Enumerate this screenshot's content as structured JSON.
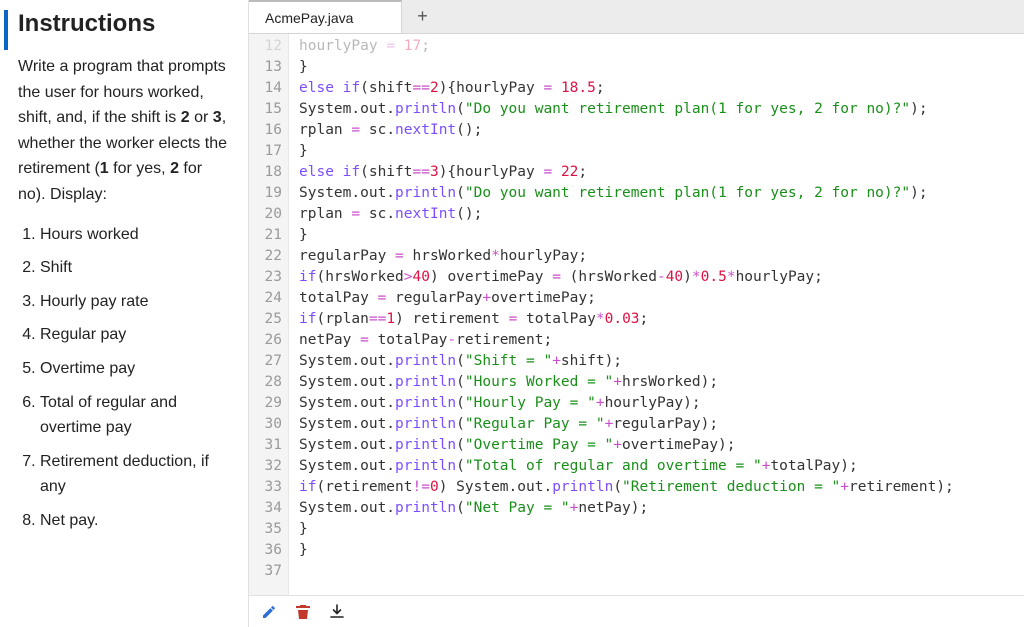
{
  "left": {
    "heading": "Instructions",
    "intro_html": "Write a program that prompts the user for hours worked, shift, and, if the shift is <b>2</b> or <b>3</b>, whether the worker elects the retirement (<b>1</b> for yes, <b>2</b> for no). Display:",
    "items": [
      "Hours worked",
      "Shift",
      "Hourly pay rate",
      "Regular pay",
      "Overtime pay",
      "Total of regular and overtime pay",
      "Retirement deduction, if any",
      "Net pay."
    ]
  },
  "tabs": {
    "active": "AcmePay.java",
    "add_label": "+"
  },
  "first_line_no": 12,
  "last_line_no": 37,
  "toolbar": {
    "edit_icon": "pencil-icon",
    "delete_icon": "trash-icon",
    "download_icon": "download-icon"
  },
  "code_lines": [
    {
      "n": 12,
      "faded": true,
      "segs": [
        [
          "id",
          "hourlyPay "
        ],
        [
          "op",
          "="
        ],
        [
          "id",
          " "
        ],
        [
          "num",
          "17"
        ],
        [
          "id",
          ";"
        ]
      ]
    },
    {
      "n": 13,
      "segs": [
        [
          "id",
          "}"
        ]
      ]
    },
    {
      "n": 14,
      "segs": [
        [
          "kw",
          "else if"
        ],
        [
          "id",
          "(shift"
        ],
        [
          "op",
          "=="
        ],
        [
          "num",
          "2"
        ],
        [
          "id",
          "){hourlyPay "
        ],
        [
          "op",
          "="
        ],
        [
          "id",
          " "
        ],
        [
          "num",
          "18.5"
        ],
        [
          "id",
          ";"
        ]
      ]
    },
    {
      "n": 15,
      "segs": [
        [
          "id",
          "System.out."
        ],
        [
          "call",
          "println"
        ],
        [
          "id",
          "("
        ],
        [
          "str",
          "\"Do you want retirement plan(1 for yes, 2 for no)?\""
        ],
        [
          "id",
          ");"
        ]
      ]
    },
    {
      "n": 16,
      "segs": [
        [
          "id",
          "rplan "
        ],
        [
          "op",
          "="
        ],
        [
          "id",
          " sc."
        ],
        [
          "call",
          "nextInt"
        ],
        [
          "id",
          "();"
        ]
      ]
    },
    {
      "n": 17,
      "segs": [
        [
          "id",
          "}"
        ]
      ]
    },
    {
      "n": 18,
      "segs": [
        [
          "kw",
          "else if"
        ],
        [
          "id",
          "(shift"
        ],
        [
          "op",
          "=="
        ],
        [
          "num",
          "3"
        ],
        [
          "id",
          "){hourlyPay "
        ],
        [
          "op",
          "="
        ],
        [
          "id",
          " "
        ],
        [
          "num",
          "22"
        ],
        [
          "id",
          ";"
        ]
      ]
    },
    {
      "n": 19,
      "segs": [
        [
          "id",
          "System.out."
        ],
        [
          "call",
          "println"
        ],
        [
          "id",
          "("
        ],
        [
          "str",
          "\"Do you want retirement plan(1 for yes, 2 for no)?\""
        ],
        [
          "id",
          ");"
        ]
      ]
    },
    {
      "n": 20,
      "segs": [
        [
          "id",
          "rplan "
        ],
        [
          "op",
          "="
        ],
        [
          "id",
          " sc."
        ],
        [
          "call",
          "nextInt"
        ],
        [
          "id",
          "();"
        ]
      ]
    },
    {
      "n": 21,
      "segs": [
        [
          "id",
          "}"
        ]
      ]
    },
    {
      "n": 22,
      "segs": [
        [
          "id",
          "regularPay "
        ],
        [
          "op",
          "="
        ],
        [
          "id",
          " hrsWorked"
        ],
        [
          "op",
          "*"
        ],
        [
          "id",
          "hourlyPay;"
        ]
      ]
    },
    {
      "n": 23,
      "segs": [
        [
          "kw",
          "if"
        ],
        [
          "id",
          "(hrsWorked"
        ],
        [
          "op",
          ">"
        ],
        [
          "num",
          "40"
        ],
        [
          "id",
          ") overtimePay "
        ],
        [
          "op",
          "="
        ],
        [
          "id",
          " (hrsWorked"
        ],
        [
          "op",
          "-"
        ],
        [
          "num",
          "40"
        ],
        [
          "id",
          ")"
        ],
        [
          "op",
          "*"
        ],
        [
          "num",
          "0.5"
        ],
        [
          "op",
          "*"
        ],
        [
          "id",
          "hourlyPay;"
        ]
      ]
    },
    {
      "n": 24,
      "segs": [
        [
          "id",
          "totalPay "
        ],
        [
          "op",
          "="
        ],
        [
          "id",
          " regularPay"
        ],
        [
          "op",
          "+"
        ],
        [
          "id",
          "overtimePay;"
        ]
      ]
    },
    {
      "n": 25,
      "segs": [
        [
          "kw",
          "if"
        ],
        [
          "id",
          "(rplan"
        ],
        [
          "op",
          "=="
        ],
        [
          "num",
          "1"
        ],
        [
          "id",
          ") retirement "
        ],
        [
          "op",
          "="
        ],
        [
          "id",
          " totalPay"
        ],
        [
          "op",
          "*"
        ],
        [
          "num",
          "0.03"
        ],
        [
          "id",
          ";"
        ]
      ]
    },
    {
      "n": 26,
      "segs": [
        [
          "id",
          "netPay "
        ],
        [
          "op",
          "="
        ],
        [
          "id",
          " totalPay"
        ],
        [
          "op",
          "-"
        ],
        [
          "id",
          "retirement;"
        ]
      ]
    },
    {
      "n": 27,
      "segs": [
        [
          "id",
          "System.out."
        ],
        [
          "call",
          "println"
        ],
        [
          "id",
          "("
        ],
        [
          "str",
          "\"Shift = \""
        ],
        [
          "op",
          "+"
        ],
        [
          "id",
          "shift);"
        ]
      ]
    },
    {
      "n": 28,
      "segs": [
        [
          "id",
          "System.out."
        ],
        [
          "call",
          "println"
        ],
        [
          "id",
          "("
        ],
        [
          "str",
          "\"Hours Worked = \""
        ],
        [
          "op",
          "+"
        ],
        [
          "id",
          "hrsWorked);"
        ]
      ]
    },
    {
      "n": 29,
      "segs": [
        [
          "id",
          "System.out."
        ],
        [
          "call",
          "println"
        ],
        [
          "id",
          "("
        ],
        [
          "str",
          "\"Hourly Pay = \""
        ],
        [
          "op",
          "+"
        ],
        [
          "id",
          "hourlyPay);"
        ]
      ]
    },
    {
      "n": 30,
      "segs": [
        [
          "id",
          "System.out."
        ],
        [
          "call",
          "println"
        ],
        [
          "id",
          "("
        ],
        [
          "str",
          "\"Regular Pay = \""
        ],
        [
          "op",
          "+"
        ],
        [
          "id",
          "regularPay);"
        ]
      ]
    },
    {
      "n": 31,
      "segs": [
        [
          "id",
          "System.out."
        ],
        [
          "call",
          "println"
        ],
        [
          "id",
          "("
        ],
        [
          "str",
          "\"Overtime Pay = \""
        ],
        [
          "op",
          "+"
        ],
        [
          "id",
          "overtimePay);"
        ]
      ]
    },
    {
      "n": 32,
      "segs": [
        [
          "id",
          "System.out."
        ],
        [
          "call",
          "println"
        ],
        [
          "id",
          "("
        ],
        [
          "str",
          "\"Total of regular and overtime = \""
        ],
        [
          "op",
          "+"
        ],
        [
          "id",
          "totalPay);"
        ]
      ]
    },
    {
      "n": 33,
      "segs": [
        [
          "kw",
          "if"
        ],
        [
          "id",
          "(retirement"
        ],
        [
          "op",
          "!="
        ],
        [
          "num",
          "0"
        ],
        [
          "id",
          ") System.out."
        ],
        [
          "call",
          "println"
        ],
        [
          "id",
          "("
        ],
        [
          "str",
          "\"Retirement deduction = \""
        ],
        [
          "op",
          "+"
        ],
        [
          "id",
          "retirement);"
        ]
      ]
    },
    {
      "n": 34,
      "segs": [
        [
          "id",
          "System.out."
        ],
        [
          "call",
          "println"
        ],
        [
          "id",
          "("
        ],
        [
          "str",
          "\"Net Pay = \""
        ],
        [
          "op",
          "+"
        ],
        [
          "id",
          "netPay);"
        ]
      ]
    },
    {
      "n": 35,
      "segs": [
        [
          "id",
          "}"
        ]
      ]
    },
    {
      "n": 36,
      "segs": [
        [
          "id",
          "}"
        ]
      ]
    },
    {
      "n": 37,
      "segs": [
        [
          "id",
          ""
        ]
      ]
    }
  ]
}
